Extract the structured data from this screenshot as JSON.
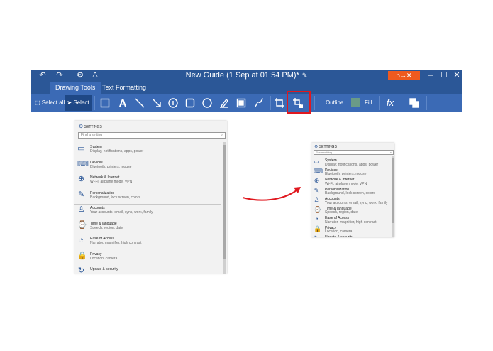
{
  "window": {
    "title": "New Guide (1 Sep at 01:54 PM)*",
    "title_icons": [
      "undo-icon",
      "redo-icon",
      "settings-icon",
      "person-icon"
    ],
    "window_buttons": [
      "–",
      "☐",
      "✕"
    ]
  },
  "tabs": [
    {
      "label": "Drawing Tools",
      "active": true
    },
    {
      "label": "Text Formatting",
      "active": false
    }
  ],
  "toolbar": {
    "select_all": "Select all",
    "select": "Select",
    "outline": "Outline",
    "fill": "Fill",
    "fill_color": "#6a9b87",
    "fx": "fx",
    "highlight_color": "#e0181f"
  },
  "settings_large": {
    "header": "SETTINGS",
    "search_placeholder": "Find a setting",
    "items": [
      {
        "name": "System",
        "desc": "Display, notifications, apps, power",
        "icon": "laptop-icon"
      },
      {
        "name": "Devices",
        "desc": "Bluetooth, printers, mouse",
        "icon": "keyboard-icon"
      },
      {
        "name": "Network & Internet",
        "desc": "Wi-Fi, airplane mode, VPN",
        "icon": "globe-icon"
      },
      {
        "name": "Personalization",
        "desc": "Background, lock screen, colors",
        "icon": "paint-icon"
      },
      {
        "name": "Accounts",
        "desc": "Your accounts, email, sync, work, family",
        "icon": "person-icon"
      },
      {
        "name": "Time & language",
        "desc": "Speech, region, date",
        "icon": "clock-icon"
      },
      {
        "name": "Ease of Access",
        "desc": "Narrator, magnifier, high contrast",
        "icon": "ease-icon"
      },
      {
        "name": "Privacy",
        "desc": "Location, camera",
        "icon": "lock-icon"
      },
      {
        "name": "Update & security",
        "desc": "",
        "icon": "update-icon"
      }
    ]
  },
  "settings_small": {
    "header": "SETTINGS",
    "search_placeholder": "Finda setting",
    "items": [
      {
        "name": "System",
        "desc": "Display, notifications, apps, power"
      },
      {
        "name": "Devices",
        "desc": "Bluetooth, printers, mouse"
      },
      {
        "name": "Network & Internet",
        "desc": "Wi-Fi, airplane mode, VPN"
      },
      {
        "name": "Personalization",
        "desc": "Background, lock screen, colors"
      },
      {
        "name": "Accounts",
        "desc": "Your accounts, email, sync, work, family"
      },
      {
        "name": "Time & language",
        "desc": "Speech, region, date"
      },
      {
        "name": "Ease of Access",
        "desc": "Narrator, magnifier, high contrast"
      },
      {
        "name": "Privacy",
        "desc": "Location, camera"
      },
      {
        "name": "Update & security",
        "desc": ""
      }
    ]
  }
}
